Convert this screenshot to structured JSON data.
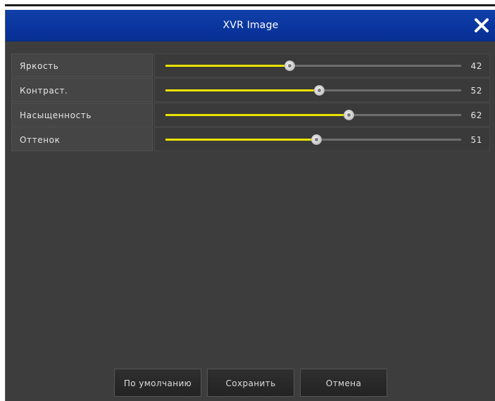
{
  "window": {
    "title": "XVR Image"
  },
  "settings": [
    {
      "label": "Яркость",
      "value": "42",
      "level": 42
    },
    {
      "label": "Контраст.",
      "value": "52",
      "level": 52
    },
    {
      "label": "Насыщенность",
      "value": "62",
      "level": 62
    },
    {
      "label": "Оттенок",
      "value": "51",
      "level": 51
    }
  ],
  "buttons": {
    "default_label": "По умолчанию",
    "save_label": "Сохранить",
    "cancel_label": "Отмена"
  },
  "colors": {
    "titlebar": "#0a36a0",
    "slider_fill": "#e8e200",
    "panel": "#3d3d3d"
  },
  "icons": {
    "close": "close-icon",
    "thumb": "slider-thumb"
  }
}
